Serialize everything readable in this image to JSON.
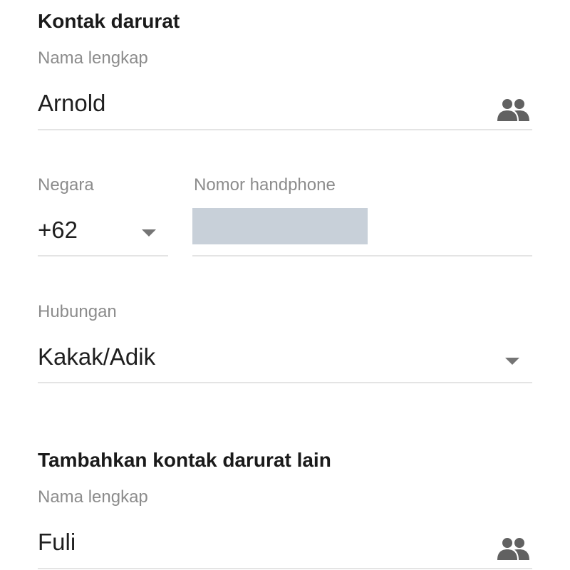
{
  "sections": {
    "primary_title": "Kontak darurat",
    "secondary_title": "Tambahkan kontak darurat lain"
  },
  "primary": {
    "name_label": "Nama lengkap",
    "name_value": "Arnold",
    "country_label": "Negara",
    "country_value": "+62",
    "phone_label": "Nomor handphone",
    "relation_label": "Hubungan",
    "relation_value": "Kakak/Adik"
  },
  "secondary": {
    "name_label": "Nama lengkap",
    "name_value": "Fuli"
  },
  "icons": {
    "contact_picker": "contacts-icon",
    "dropdown": "chevron-down-icon"
  },
  "colors": {
    "label": "#8c8c8c",
    "text": "#1f1f1f",
    "divider": "#e4e4e4",
    "redaction": "#c8d0d9",
    "icon": "#616161"
  }
}
